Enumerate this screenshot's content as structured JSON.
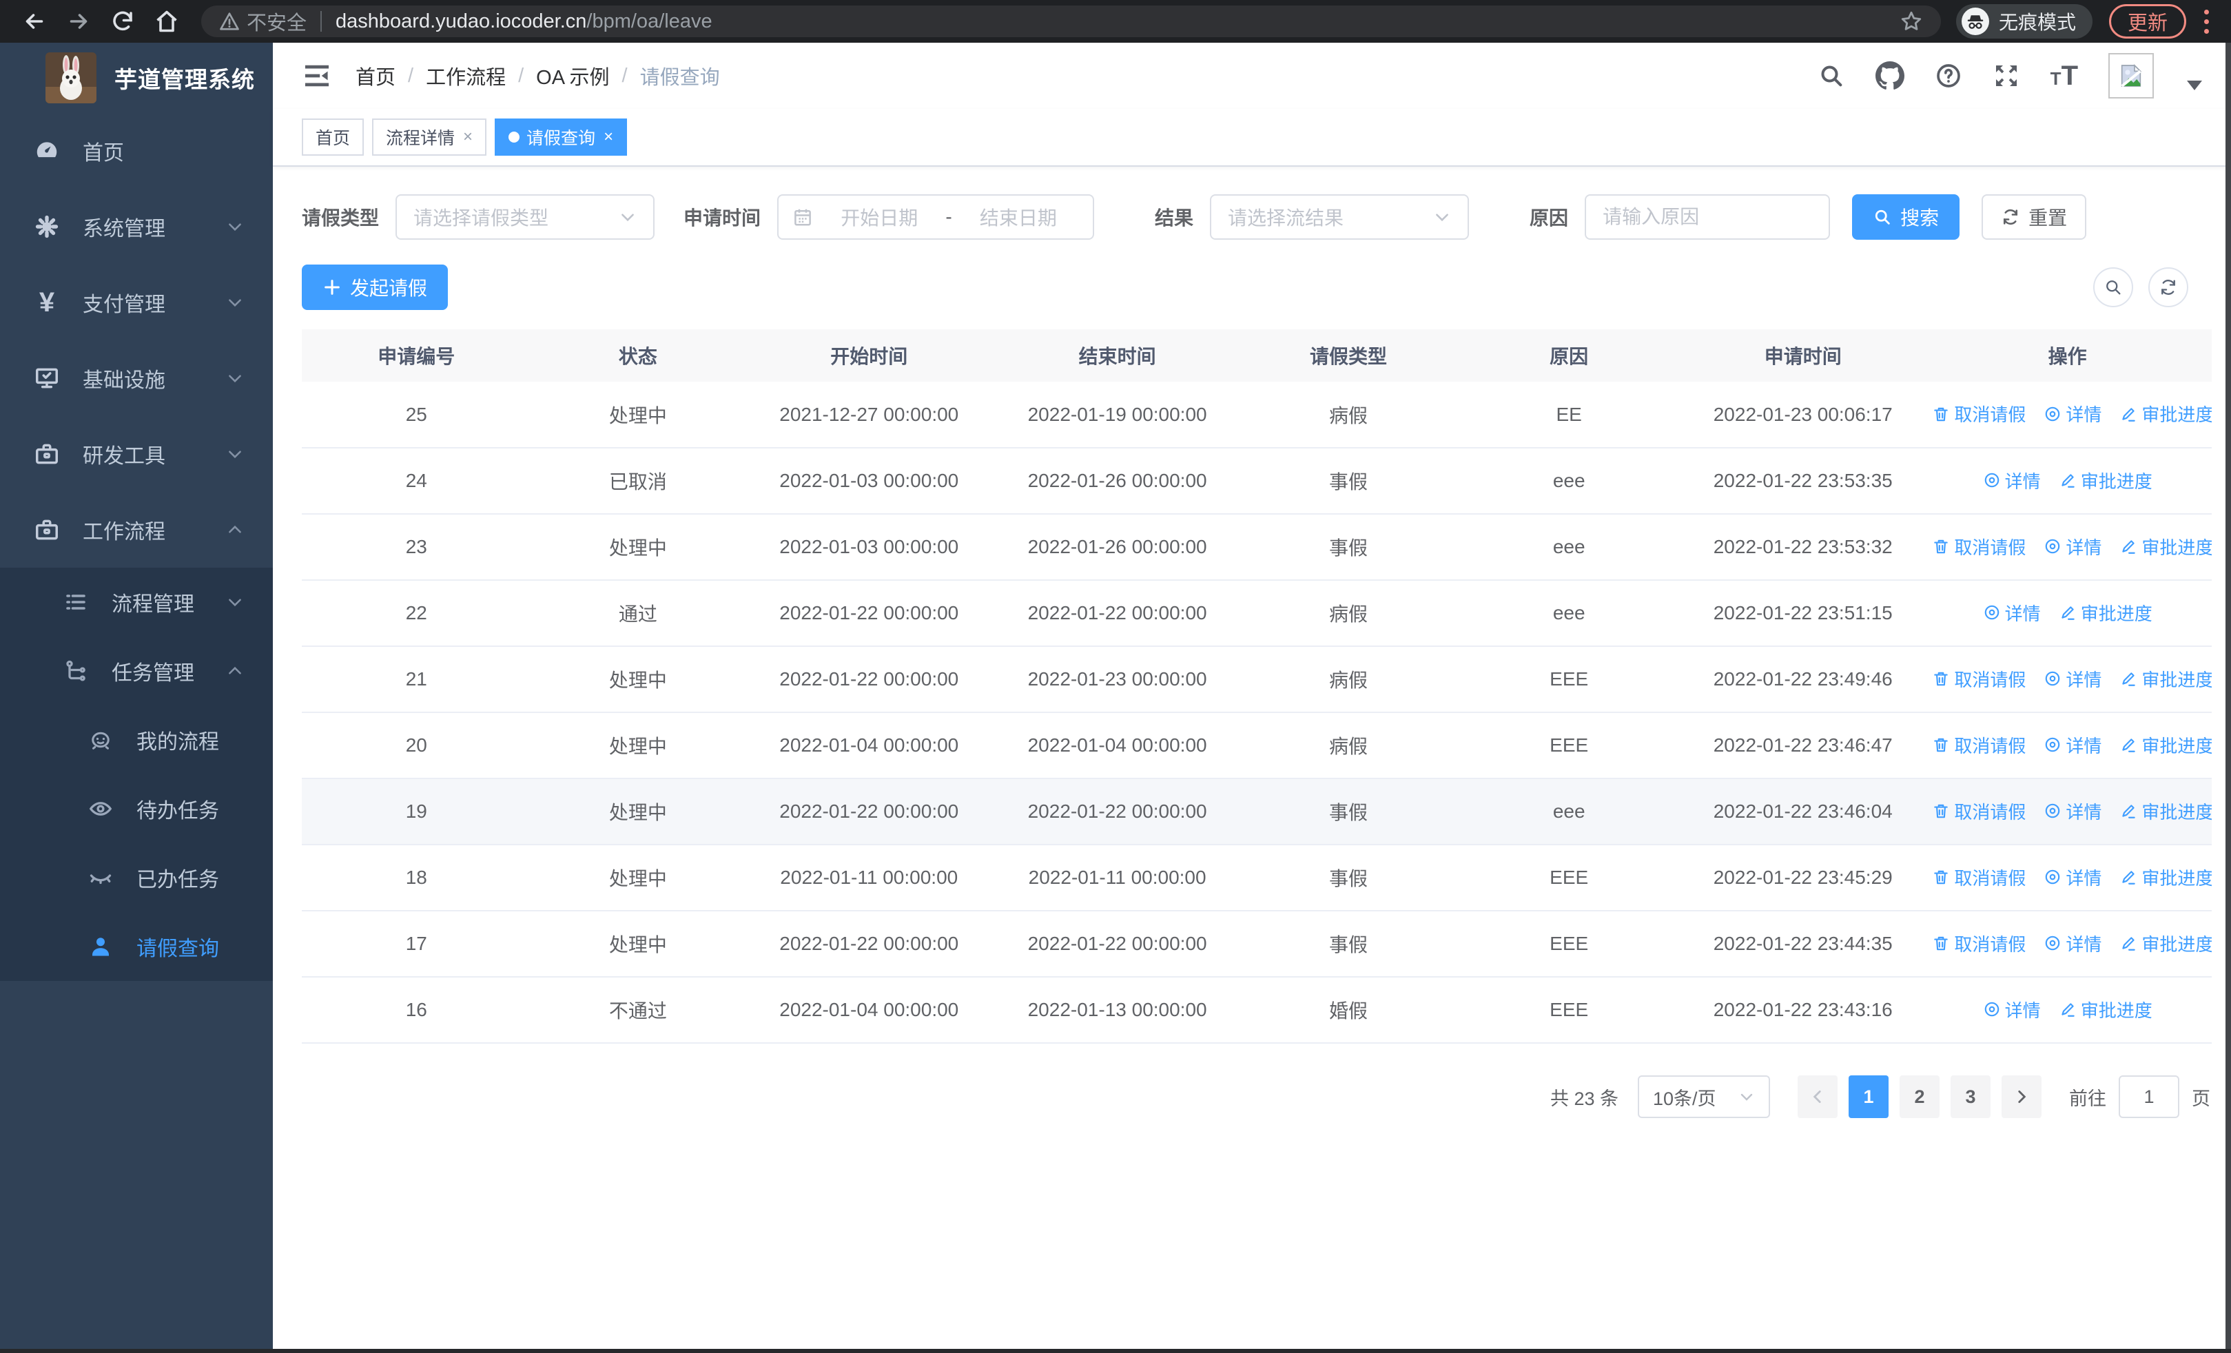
{
  "browser": {
    "security_label": "不安全",
    "url_host": "dashboard.yudao.iocoder.cn",
    "url_path": "/bpm/oa/leave",
    "incognito_label": "无痕模式",
    "update_label": "更新"
  },
  "sidebar": {
    "logo_title": "芋道管理系统",
    "items": [
      {
        "label": "首页"
      },
      {
        "label": "系统管理"
      },
      {
        "label": "支付管理"
      },
      {
        "label": "基础设施"
      },
      {
        "label": "研发工具"
      },
      {
        "label": "工作流程"
      },
      {
        "label": "流程管理"
      },
      {
        "label": "任务管理"
      },
      {
        "label": "我的流程"
      },
      {
        "label": "待办任务"
      },
      {
        "label": "已办任务"
      },
      {
        "label": "请假查询"
      }
    ]
  },
  "header": {
    "breadcrumb": [
      "首页",
      "工作流程",
      "OA 示例",
      "请假查询"
    ]
  },
  "tags": [
    {
      "label": "首页"
    },
    {
      "label": "流程详情"
    },
    {
      "label": "请假查询"
    }
  ],
  "filters": {
    "leave_type_label": "请假类型",
    "leave_type_placeholder": "请选择请假类型",
    "apply_time_label": "申请时间",
    "start_date_placeholder": "开始日期",
    "range_separator": "-",
    "end_date_placeholder": "结束日期",
    "result_label": "结果",
    "result_placeholder": "请选择流结果",
    "reason_label": "原因",
    "reason_placeholder": "请输入原因",
    "search_label": "搜索",
    "reset_label": "重置"
  },
  "toolbar": {
    "create_label": "发起请假"
  },
  "table": {
    "columns": [
      "申请编号",
      "状态",
      "开始时间",
      "结束时间",
      "请假类型",
      "原因",
      "申请时间",
      "操作"
    ],
    "action_labels": {
      "cancel": "取消请假",
      "detail": "详情",
      "progress": "审批进度"
    },
    "rows": [
      {
        "id": "25",
        "status": "处理中",
        "start_time": "2021-12-27 00:00:00",
        "end_time": "2022-01-19 00:00:00",
        "leave_type": "病假",
        "reason": "EE",
        "apply_time": "2022-01-23 00:06:17",
        "actions": [
          "cancel",
          "detail",
          "progress"
        ],
        "highlighted": false
      },
      {
        "id": "24",
        "status": "已取消",
        "start_time": "2022-01-03 00:00:00",
        "end_time": "2022-01-26 00:00:00",
        "leave_type": "事假",
        "reason": "eee",
        "apply_time": "2022-01-22 23:53:35",
        "actions": [
          "detail",
          "progress"
        ],
        "highlighted": false
      },
      {
        "id": "23",
        "status": "处理中",
        "start_time": "2022-01-03 00:00:00",
        "end_time": "2022-01-26 00:00:00",
        "leave_type": "事假",
        "reason": "eee",
        "apply_time": "2022-01-22 23:53:32",
        "actions": [
          "cancel",
          "detail",
          "progress"
        ],
        "highlighted": false
      },
      {
        "id": "22",
        "status": "通过",
        "start_time": "2022-01-22 00:00:00",
        "end_time": "2022-01-22 00:00:00",
        "leave_type": "病假",
        "reason": "eee",
        "apply_time": "2022-01-22 23:51:15",
        "actions": [
          "detail",
          "progress"
        ],
        "highlighted": false
      },
      {
        "id": "21",
        "status": "处理中",
        "start_time": "2022-01-22 00:00:00",
        "end_time": "2022-01-23 00:00:00",
        "leave_type": "病假",
        "reason": "EEE",
        "apply_time": "2022-01-22 23:49:46",
        "actions": [
          "cancel",
          "detail",
          "progress"
        ],
        "highlighted": false
      },
      {
        "id": "20",
        "status": "处理中",
        "start_time": "2022-01-04 00:00:00",
        "end_time": "2022-01-04 00:00:00",
        "leave_type": "病假",
        "reason": "EEE",
        "apply_time": "2022-01-22 23:46:47",
        "actions": [
          "cancel",
          "detail",
          "progress"
        ],
        "highlighted": false
      },
      {
        "id": "19",
        "status": "处理中",
        "start_time": "2022-01-22 00:00:00",
        "end_time": "2022-01-22 00:00:00",
        "leave_type": "事假",
        "reason": "eee",
        "apply_time": "2022-01-22 23:46:04",
        "actions": [
          "cancel",
          "detail",
          "progress"
        ],
        "highlighted": true
      },
      {
        "id": "18",
        "status": "处理中",
        "start_time": "2022-01-11 00:00:00",
        "end_time": "2022-01-11 00:00:00",
        "leave_type": "事假",
        "reason": "EEE",
        "apply_time": "2022-01-22 23:45:29",
        "actions": [
          "cancel",
          "detail",
          "progress"
        ],
        "highlighted": false
      },
      {
        "id": "17",
        "status": "处理中",
        "start_time": "2022-01-22 00:00:00",
        "end_time": "2022-01-22 00:00:00",
        "leave_type": "事假",
        "reason": "EEE",
        "apply_time": "2022-01-22 23:44:35",
        "actions": [
          "cancel",
          "detail",
          "progress"
        ],
        "highlighted": false
      },
      {
        "id": "16",
        "status": "不通过",
        "start_time": "2022-01-04 00:00:00",
        "end_time": "2022-01-13 00:00:00",
        "leave_type": "婚假",
        "reason": "EEE",
        "apply_time": "2022-01-22 23:43:16",
        "actions": [
          "detail",
          "progress"
        ],
        "highlighted": false
      }
    ]
  },
  "pagination": {
    "total_text": "共 23 条",
    "page_size": "10条/页",
    "pages": [
      "1",
      "2",
      "3"
    ],
    "active_page": "1",
    "goto_label": "前往",
    "goto_value": "1",
    "page_unit": "页"
  },
  "colors": {
    "accent": "#409eff",
    "sidebar_bg": "#304156",
    "submenu_bg": "#26364a",
    "chrome_bg": "#1f2124",
    "update_accent": "#f28b82"
  }
}
